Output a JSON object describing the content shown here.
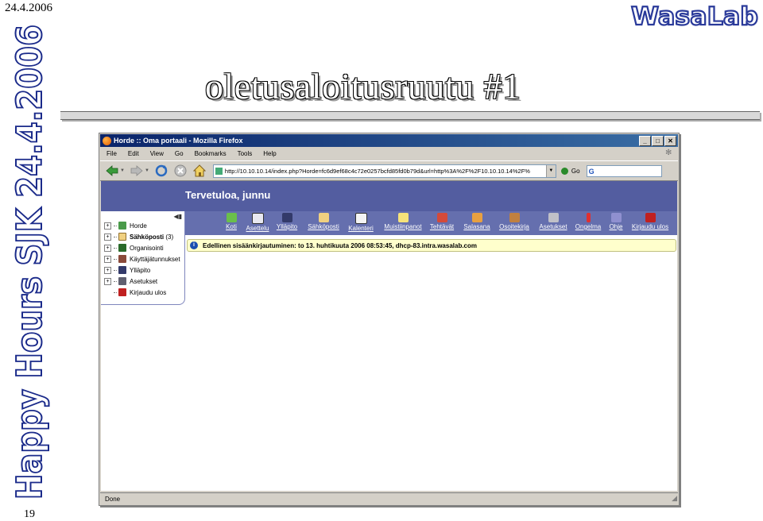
{
  "slide": {
    "date": "24.4.2006",
    "page_number": "19",
    "side_banner": "Happy Hours SJK 24.4.2006",
    "logo": "WasaLab",
    "title": "oletusaloitusruutu #1"
  },
  "browser": {
    "window_title": "Horde :: Oma portaali - Mozilla Firefox",
    "window_buttons": [
      "_",
      "□",
      "✕"
    ],
    "menu": [
      "File",
      "Edit",
      "View",
      "Go",
      "Bookmarks",
      "Tools",
      "Help"
    ],
    "url": "http://10.10.10.14/index.php?Horde=fc6d9ef68c4c72e0257bcfd85fd0b79d&url=http%3A%2F%2F10.10.10.14%2F%",
    "go_label": "Go",
    "search_value": "G",
    "status": "Done"
  },
  "horde": {
    "welcome": "Tervetuloa, junnu",
    "toolbar": [
      {
        "label": "Koti",
        "icon": "home-icon",
        "color": "#6abf4b"
      },
      {
        "label": "Asettelu",
        "icon": "layout-grid-icon",
        "color": "#e8e8f0"
      },
      {
        "label": "Ylläpito",
        "icon": "admin-people-icon",
        "color": "#333a6a"
      },
      {
        "label": "Sähköposti",
        "icon": "envelope-icon",
        "color": "#f0d080"
      },
      {
        "label": "Kalenteri",
        "icon": "calendar-icon",
        "color": "#f4f4f4"
      },
      {
        "label": "Muistiinpanot",
        "icon": "notepad-icon",
        "color": "#f6e27a"
      },
      {
        "label": "Tehtävät",
        "icon": "tasks-icon",
        "color": "#d44a3a"
      },
      {
        "label": "Salasana",
        "icon": "lock-icon",
        "color": "#e8a040"
      },
      {
        "label": "Osoitekirja",
        "icon": "address-book-icon",
        "color": "#c08040"
      },
      {
        "label": "Asetukset",
        "icon": "tools-icon",
        "color": "#c0c0c8"
      },
      {
        "label": "Ongelma",
        "icon": "exclamation-icon",
        "color": "#e03030"
      },
      {
        "label": "Ohje",
        "icon": "help-icon",
        "color": "#9090d0"
      },
      {
        "label": "Kirjaudu ulos",
        "icon": "logout-door-icon",
        "color": "#c02020"
      }
    ],
    "sidebar": [
      {
        "label": "Horde",
        "icon": "horde-icon",
        "color": "#4a9a4a",
        "bold": false
      },
      {
        "label": "Sähköposti",
        "count": "(3)",
        "icon": "envelope-icon",
        "color": "#f0d080",
        "bold": true
      },
      {
        "label": "Organisointi",
        "icon": "organizer-icon",
        "color": "#2a6a2a",
        "bold": false
      },
      {
        "label": "Käyttäjätunnukset",
        "icon": "user-accounts-icon",
        "color": "#8a4a3a",
        "bold": false
      },
      {
        "label": "Ylläpito",
        "icon": "admin-people-icon",
        "color": "#333a6a",
        "bold": false
      },
      {
        "label": "Asetukset",
        "icon": "tools-icon",
        "color": "#606070",
        "bold": false
      },
      {
        "label": "Kirjaudu ulos",
        "icon": "logout-door-icon",
        "color": "#c02020",
        "bold": false
      }
    ],
    "notice": "Edellinen sisäänkirjautuminen: to 13. huhtikuuta 2006 08:53:45, dhcp-83.intra.wasalab.com"
  }
}
